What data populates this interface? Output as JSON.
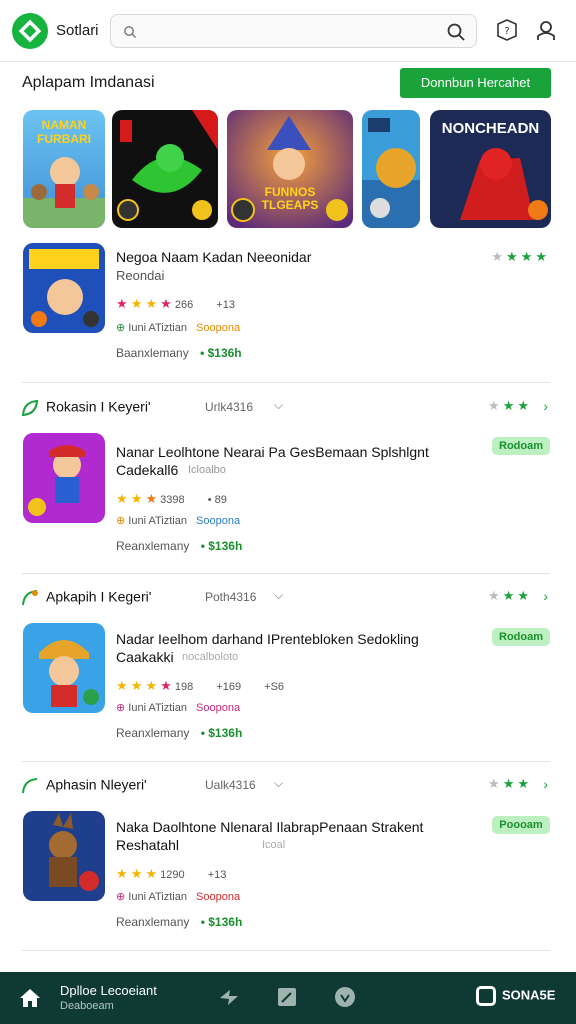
{
  "header": {
    "brand": "Sotlari",
    "search_placeholder": "",
    "icons": [
      "app-logo-icon",
      "search-icon",
      "help-icon",
      "profile-icon"
    ]
  },
  "section": {
    "title": "Aplapam Imdanasi",
    "cta_label": "Donnbun Hercahet"
  },
  "featured": [
    {
      "label": "NAMAN FURBARI"
    },
    {
      "label": ""
    },
    {
      "label": "FUNNOS TLGEAPS"
    },
    {
      "label": ""
    },
    {
      "label": "NONCHEADN"
    }
  ],
  "apps": [
    {
      "title": "Negoa Naam Kadan Neeonidar",
      "subtitle": "Reondai",
      "rating_value": "266",
      "extra": "+13",
      "meta1": "Iuni ATiztian",
      "meta2": "Soopona",
      "price_label": "Baanxlemany",
      "price": "• $136h",
      "stars_right": [
        "gray",
        "green",
        "green",
        "green"
      ]
    },
    {
      "category": "Rokasin I Keyeri'",
      "count": "Urlk4316",
      "title": "Nanar Leolhtone Nearai Pa GesBemaan Splshlgnt",
      "title2": "Cadekall6",
      "subtitle": "Icloalbo",
      "rating_value": "3398",
      "extra": "• 89",
      "meta1": "Iuni ATiztian",
      "meta2": "Soopona",
      "price_label": "Reanxlemany",
      "price": "• $136h",
      "badge": "Rodoam",
      "stars_right": [
        "gray",
        "green",
        "green"
      ]
    },
    {
      "category": "Apkapih I Kegeri'",
      "count": "Poth4316",
      "title": "Nadar Ieelhom darhand IPrentebloken Sedokling",
      "title2": "Caakakki",
      "subtitle": "nocalboloto",
      "rating_value": "198",
      "extra": "+169",
      "extra2": "+S6",
      "meta1": "Iuni ATiztian",
      "meta2": "Soopona",
      "price_label": "Reanxlemany",
      "price": "• $136h",
      "badge": "Rodoam",
      "stars_right": [
        "gray",
        "green",
        "green"
      ]
    },
    {
      "category": "Aphasin Nleyeri'",
      "count": "Ualk4316",
      "title": "Naka Daolhtone Nlenaral IlabrapPenaan Strakent",
      "title2": "Reshatahl",
      "subtitle": "Icoal",
      "rating_value": "1290",
      "extra": "+13",
      "meta1": "Iuni ATiztian",
      "meta2": "Soopona",
      "price_label": "Reanxlemany",
      "price": "• $136h",
      "badge": "Poooam",
      "stars_right": [
        "gray",
        "green",
        "green"
      ]
    }
  ],
  "bottom_nav": {
    "title": "Dplloe Lecoeiant",
    "subtitle": "Deaboeam",
    "button": "SONA5E"
  },
  "colors": {
    "brand_green": "#1aa23b",
    "nav_bg": "#0e3a33",
    "badge_bg": "#bdf0c0"
  }
}
